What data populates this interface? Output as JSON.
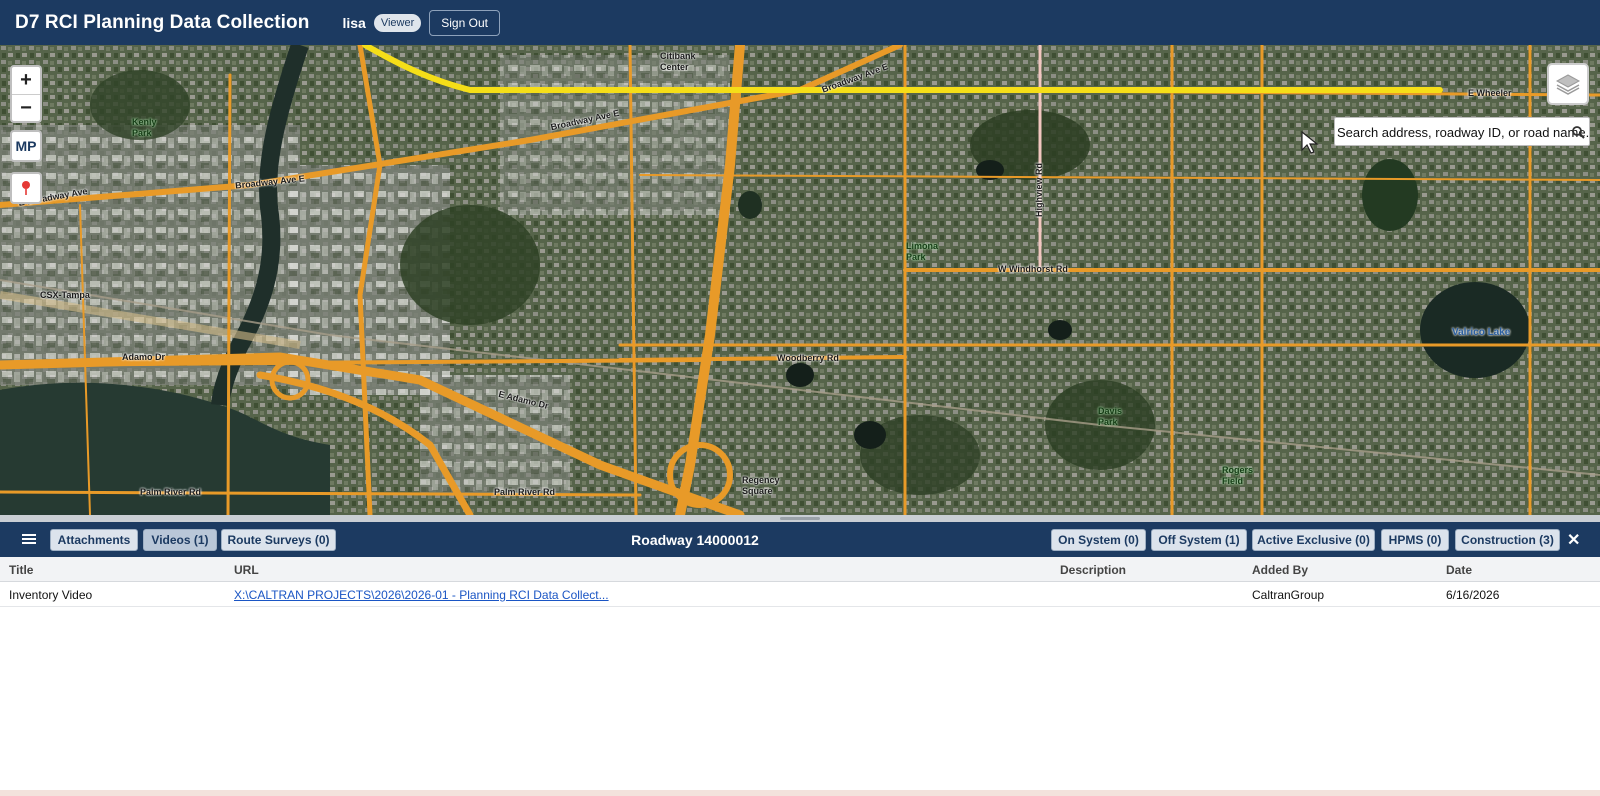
{
  "header": {
    "app_title": "D7 RCI Planning Data Collection",
    "user_name": "lisa",
    "role_badge": "Viewer",
    "signout_label": "Sign Out"
  },
  "map": {
    "zoom_in_label": "+",
    "zoom_out_label": "−",
    "mp_label": "MP",
    "pin_icon": "map-pin-icon",
    "layers_icon": "layers-icon",
    "search_placeholder": "Search address, roadway ID, or road name.",
    "labels": {
      "citibank": "Citibank\nCenter",
      "kenly": "Kenly\nPark",
      "broadway_1": "Broadway Ave E",
      "broadway_2": "Broadway Ave E",
      "broadway_3": "Broadway Ave E",
      "broadway_4": "E Broadway Ave",
      "csx": "CSX-Tampa",
      "adamo": "Adamo Dr",
      "e_adamo": "E Adamo Dr",
      "palm_river_1": "Palm River Rd",
      "palm_river_2": "Palm River Rd",
      "woodberry": "Woodberry Rd",
      "wirdhorst": "W Windhorst Rd",
      "limona": "Limona\nPark",
      "highview": "Highview Rd",
      "davis": "Davis\nPark",
      "rogers": "Rogers\nField",
      "regency": "Regency\nSquare",
      "valrico": "Valrico Lake",
      "e_wheeler": "E Wheeler"
    }
  },
  "panel": {
    "menu_icon": "hamburger-menu-icon",
    "tabs_left": [
      {
        "label": "Attachments"
      },
      {
        "label": "Videos (1)"
      },
      {
        "label": "Route Surveys (0)"
      }
    ],
    "title": "Roadway 14000012",
    "tabs_right": [
      {
        "label": "On System (0)"
      },
      {
        "label": "Off System (1)"
      },
      {
        "label": "Active Exclusive (0)"
      },
      {
        "label": "HPMS (0)"
      },
      {
        "label": "Construction (3)"
      }
    ],
    "close_label": "✕",
    "table": {
      "headers": [
        "Title",
        "URL",
        "Description",
        "Added By",
        "Date"
      ],
      "rows": [
        {
          "title": "Inventory Video",
          "url": "X:\\CALTRAN PROJECTS\\2026\\2026-01 - Planning RCI Data Collect...",
          "description": "",
          "added_by": "CaltranGroup",
          "date": "6/16/2026"
        }
      ]
    }
  }
}
